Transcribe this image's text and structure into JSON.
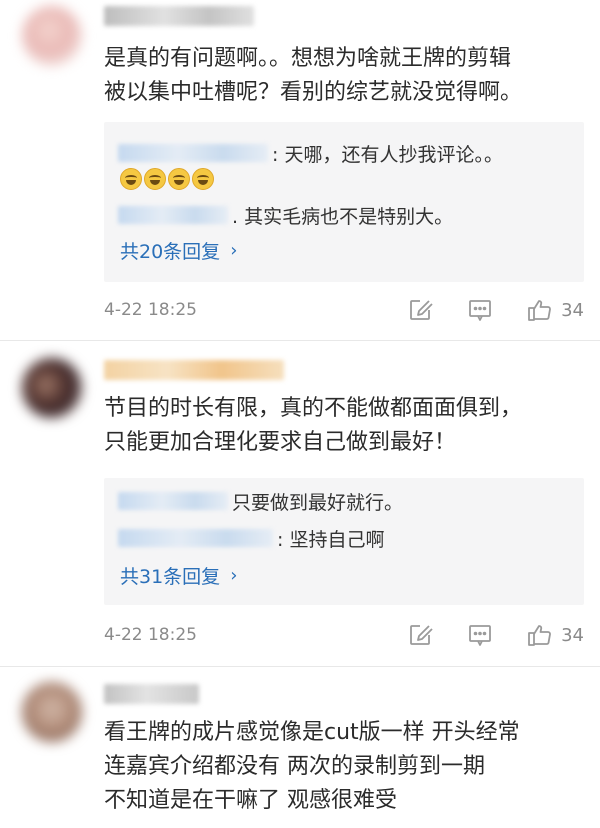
{
  "comments": [
    {
      "text": "是真的有问题啊。。想想为啥就王牌的剪辑\n被以集中吐槽呢？看别的综艺就没觉得啊。",
      "replies": [
        {
          "text": ": 天哪，还有人抄我评论。。",
          "emoji_count": 4
        },
        {
          "text": ". 其实毛病也不是特别大。"
        }
      ],
      "more_replies": "共20条回复",
      "time": "4-22 18:25",
      "likes": "34"
    },
    {
      "text": "节目的时长有限，真的不能做都面面俱到，\n只能更加合理化要求自己做到最好！",
      "replies": [
        {
          "text": "只要做到最好就行。"
        },
        {
          "text": ": 坚持自己啊"
        }
      ],
      "more_replies": "共31条回复",
      "time": "4-22 18:25",
      "likes": "34"
    },
    {
      "text": "看王牌的成片感觉像是cut版一样  开头经常\n连嘉宾介绍都没有   两次的录制剪到一期\n不知道是在干嘛了  观感很难受"
    }
  ],
  "icons": {
    "more_replies": "chevron-right-icon",
    "repost": "edit-square-icon",
    "comment": "comment-bubble-icon",
    "like": "thumbs-up-icon"
  },
  "colors": {
    "link": "#2a6fb8",
    "meta": "#8a8a8a",
    "reply_bg": "#f5f5f6"
  }
}
